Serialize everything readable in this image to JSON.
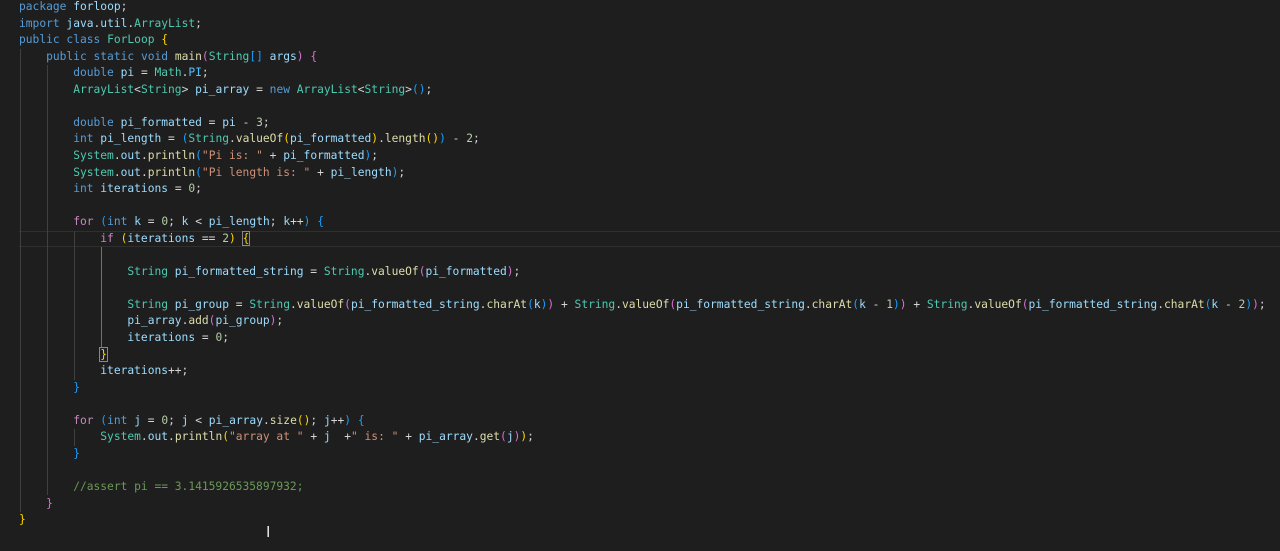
{
  "editor": {
    "language": "java",
    "theme": "Dark+",
    "current_line": 15,
    "lines": [
      "package forloop;",
      "import java.util.ArrayList;",
      "public class ForLoop {",
      "    public static void main(String[] args) {",
      "        double pi = Math.PI;",
      "        ArrayList<String> pi_array = new ArrayList<String>();",
      "",
      "        double pi_formatted = pi - 3;",
      "        int pi_length = (String.valueOf(pi_formatted).length()) - 2;",
      "        System.out.println(\"Pi is: \" + pi_formatted);",
      "        System.out.println(\"Pi length is: \" + pi_length);",
      "        int iterations = 0;",
      "",
      "        for (int k = 0; k < pi_length; k++) {",
      "            if (iterations == 2) {",
      "",
      "                String pi_formatted_string = String.valueOf(pi_formatted);",
      "",
      "                String pi_group = String.valueOf(pi_formatted_string.charAt(k)) + String.valueOf(pi_formatted_string.charAt(k - 1)) + String.valueOf(pi_formatted_string.charAt(k - 2));",
      "                pi_array.add(pi_group);",
      "                iterations = 0;",
      "            }",
      "            iterations++;",
      "        }",
      "",
      "        for (int j = 0; j < pi_array.size(); j++) {",
      "            System.out.println(\"array at \" + j  +\" is: \" + pi_array.get(j));",
      "        }",
      "",
      "        //assert pi == 3.1415926535897932;",
      "    }",
      "}"
    ]
  },
  "colors": {
    "background": "#1e1e1e",
    "keyword": "#569cd6",
    "control": "#c586c0",
    "type": "#4ec9b0",
    "function": "#dcdcaa",
    "variable": "#9cdcfe",
    "string": "#ce9178",
    "number": "#b5cea8",
    "comment": "#6a9955"
  }
}
